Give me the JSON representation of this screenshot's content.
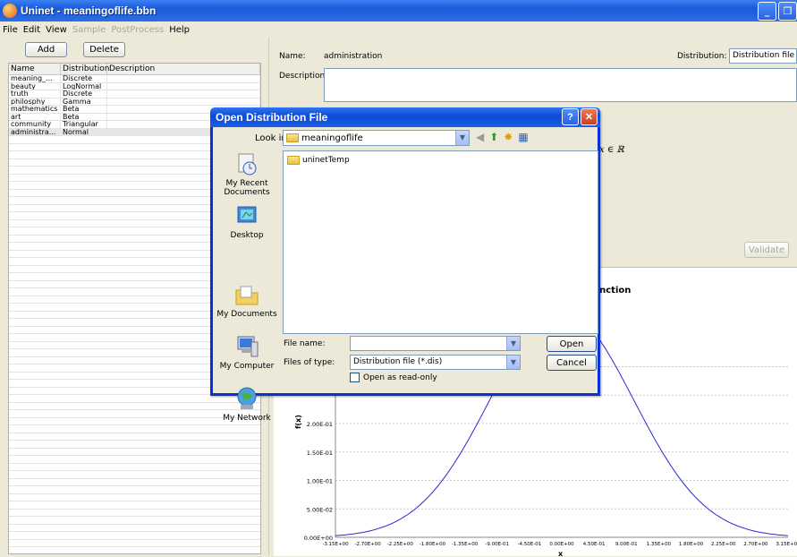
{
  "window": {
    "title": "Uninet - meaningoflife.bbn"
  },
  "menu": [
    {
      "label": "File",
      "enabled": true
    },
    {
      "label": "Edit",
      "enabled": true
    },
    {
      "label": "View",
      "enabled": true
    },
    {
      "label": "Sample",
      "enabled": false
    },
    {
      "label": "PostProcess",
      "enabled": false
    },
    {
      "label": "Help",
      "enabled": true
    }
  ],
  "left": {
    "add_label": "Add",
    "delete_label": "Delete",
    "columns": [
      "Name",
      "Distribution",
      "Description"
    ],
    "rows": [
      {
        "name": "meaning_...",
        "distribution": "Discrete",
        "description": ""
      },
      {
        "name": "beauty",
        "distribution": "LogNormal",
        "description": ""
      },
      {
        "name": "truth",
        "distribution": "Discrete",
        "description": ""
      },
      {
        "name": "philosphy",
        "distribution": "Gamma",
        "description": ""
      },
      {
        "name": "mathematics",
        "distribution": "Beta",
        "description": ""
      },
      {
        "name": "art",
        "distribution": "Beta",
        "description": ""
      },
      {
        "name": "community",
        "distribution": "Triangular",
        "description": ""
      },
      {
        "name": "administra...",
        "distribution": "Normal",
        "description": ""
      }
    ]
  },
  "right": {
    "name_label": "Name:",
    "name_value": "administration",
    "distribution_label": "Distribution:",
    "distribution_value": "Distribution file",
    "description_label": "Description:",
    "formula": "x ∈ ℝ",
    "validate_label": "Validate",
    "chart_title": "unction"
  },
  "chart_data": {
    "type": "line",
    "title": "unction",
    "xlabel": "x",
    "ylabel": "f(x)",
    "x_ticks": [
      "-3.15E+00",
      "-2.70E+00",
      "-2.25E+00",
      "-1.80E+00",
      "-1.35E+00",
      "-9.00E-01",
      "-4.50E-01",
      "0.00E+00",
      "4.50E-01",
      "9.00E-01",
      "1.35E+00",
      "1.80E+00",
      "2.25E+00",
      "2.70E+00",
      "3.15E+00"
    ],
    "y_ticks": [
      "0.00E+00",
      "5.00E-02",
      "1.00E-01",
      "1.50E-01",
      "2.00E-01"
    ],
    "xlim": [
      -3.15,
      3.15
    ],
    "ylim_visible": [
      0,
      0.4
    ],
    "series": [
      {
        "distribution": "normal",
        "mean": 0,
        "sd": 1,
        "color": "#2b2bd0"
      }
    ]
  },
  "dialog": {
    "title": "Open Distribution File",
    "lookin_label": "Look in:",
    "lookin_value": "meaningoflife",
    "places": [
      "My Recent Documents",
      "Desktop",
      "My Documents",
      "My Computer",
      "My Network"
    ],
    "files": [
      "uninetTemp"
    ],
    "filename_label": "File name:",
    "filename_value": "",
    "filetype_label": "Files of type:",
    "filetype_value": "Distribution file (*.dis)",
    "open_label": "Open",
    "cancel_label": "Cancel",
    "readonly_label": "Open as read-only"
  }
}
